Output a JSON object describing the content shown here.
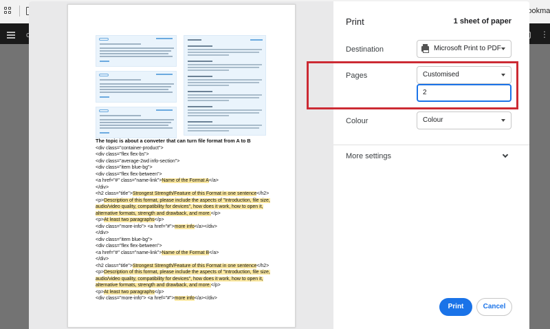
{
  "browser": {
    "bookmarks_label": "Bookmarks",
    "toolbar_letter": "c"
  },
  "print_dialog": {
    "title": "Print",
    "sheet_count": "1 sheet of paper",
    "destination": {
      "label": "Destination",
      "value": "Microsoft Print to PDF"
    },
    "pages": {
      "label": "Pages",
      "value": "Customised",
      "input_value": "2"
    },
    "colour": {
      "label": "Colour",
      "value": "Colour"
    },
    "more_settings_label": "More settings",
    "print_button": "Print",
    "cancel_button": "Cancel",
    "highlight_color": "#cc2a33",
    "accent_color": "#1a73e8"
  },
  "preview": {
    "heading": "The topic is about a conveter that can turn file format from A to B",
    "lines": [
      {
        "parts": [
          {
            "t": "<div class=\"container-product\">",
            "hl": false
          }
        ]
      },
      {
        "parts": [
          {
            "t": "<div class=\"flex flex-bs\">",
            "hl": false
          }
        ]
      },
      {
        "parts": [
          {
            "t": "<div class=\"average-2wd info-section\">",
            "hl": false
          }
        ]
      },
      {
        "parts": [
          {
            "t": "<div class=\"item blue-bg\">",
            "hl": false
          }
        ]
      },
      {
        "parts": [
          {
            "t": "<div class=\"flex flex-between\">",
            "hl": false
          }
        ]
      },
      {
        "parts": [
          {
            "t": "<a href=\"#\" class=\"name-link\">",
            "hl": false
          },
          {
            "t": "Name of the Format A",
            "hl": true
          },
          {
            "t": "</a>",
            "hl": false
          }
        ]
      },
      {
        "parts": [
          {
            "t": "</div>",
            "hl": false
          }
        ]
      },
      {
        "parts": [
          {
            "t": "<h2 class=\"title\">",
            "hl": false
          },
          {
            "t": "Strongest Strength/Feature of this Format in one sentence",
            "hl": true
          },
          {
            "t": "</h2>",
            "hl": false
          }
        ]
      },
      {
        "parts": [
          {
            "t": "<p>",
            "hl": false
          },
          {
            "t": "Description of this format, please include the aspects of \"Introduction, file size,",
            "hl": true
          }
        ]
      },
      {
        "parts": [
          {
            "t": "audio/video quality, compatibility for devices\", how does it work, how to open it,",
            "hl": true
          }
        ]
      },
      {
        "parts": [
          {
            "t": "alternative formats, strength and drawback, and more.",
            "hl": true
          },
          {
            "t": "</p>",
            "hl": false
          }
        ]
      },
      {
        "parts": [
          {
            "t": "<p>",
            "hl": false
          },
          {
            "t": "At least two paragraphs",
            "hl": true
          },
          {
            "t": "</p>",
            "hl": false
          }
        ]
      },
      {
        "parts": [
          {
            "t": "<div class=\"more-info\"> <a href=\"#\">",
            "hl": false
          },
          {
            "t": "more info",
            "hl": true
          },
          {
            "t": "</a></div>",
            "hl": false
          }
        ]
      },
      {
        "parts": [
          {
            "t": "</div>",
            "hl": false
          }
        ]
      },
      {
        "parts": [
          {
            "t": "<div class=\"item blue-bg\">",
            "hl": false
          }
        ]
      },
      {
        "parts": [
          {
            "t": "<div class=\"flex flex-between\">",
            "hl": false
          }
        ]
      },
      {
        "parts": [
          {
            "t": "<a href=\"#\" class=\"name-link\">",
            "hl": false
          },
          {
            "t": "Name of the Format B",
            "hl": true
          },
          {
            "t": "</a>",
            "hl": false
          }
        ]
      },
      {
        "parts": [
          {
            "t": "</div>",
            "hl": false
          }
        ]
      },
      {
        "parts": [
          {
            "t": "<h2 class=\"title\">",
            "hl": false
          },
          {
            "t": "Strongest Strength/Feature of this Format in one sentence",
            "hl": true
          },
          {
            "t": "</h2>",
            "hl": false
          }
        ]
      },
      {
        "parts": [
          {
            "t": "<p>",
            "hl": false
          },
          {
            "t": "Description of this format, please include the aspects of \"Introduction, file size,",
            "hl": true
          }
        ]
      },
      {
        "parts": [
          {
            "t": "audio/video quality, compatibility for devices\", how does it work, how to open it,",
            "hl": true
          }
        ]
      },
      {
        "parts": [
          {
            "t": "alternative formats, strength and drawback, and more.",
            "hl": true
          },
          {
            "t": "</p>",
            "hl": false
          }
        ]
      },
      {
        "parts": [
          {
            "t": "<p>",
            "hl": false
          },
          {
            "t": "At least two paragraphs",
            "hl": true
          },
          {
            "t": "</p>",
            "hl": false
          }
        ]
      },
      {
        "parts": [
          {
            "t": "<div class=\"more-info\"> <a href=\"#\">",
            "hl": false
          },
          {
            "t": "more info",
            "hl": true
          },
          {
            "t": "</a></div>",
            "hl": false
          }
        ]
      }
    ]
  }
}
